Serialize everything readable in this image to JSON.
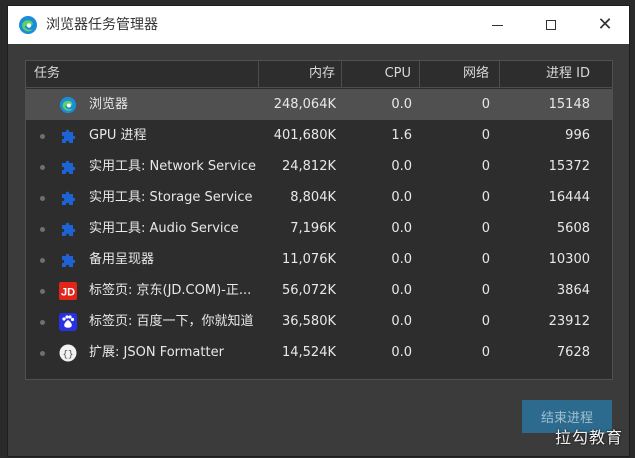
{
  "window": {
    "title": "浏览器任务管理器",
    "minimize_symbol": "",
    "close_symbol": "✕"
  },
  "table": {
    "headers": {
      "task": "任务",
      "memory": "内存",
      "cpu": "CPU",
      "network": "网络",
      "pid": "进程 ID"
    },
    "rows": [
      {
        "name": "浏览器",
        "memory": "248,064K",
        "cpu": "0.0",
        "network": "0",
        "pid": "15148",
        "icon": "edge-icon",
        "selected": true
      },
      {
        "name": "GPU 进程",
        "memory": "401,680K",
        "cpu": "1.6",
        "network": "0",
        "pid": "996",
        "icon": "puzzle-icon",
        "selected": false
      },
      {
        "name": "实用工具: Network Service",
        "memory": "24,812K",
        "cpu": "0.0",
        "network": "0",
        "pid": "15372",
        "icon": "puzzle-icon",
        "selected": false
      },
      {
        "name": "实用工具: Storage Service",
        "memory": "8,804K",
        "cpu": "0.0",
        "network": "0",
        "pid": "16444",
        "icon": "puzzle-icon",
        "selected": false
      },
      {
        "name": "实用工具: Audio Service",
        "memory": "7,196K",
        "cpu": "0.0",
        "network": "0",
        "pid": "5608",
        "icon": "puzzle-icon",
        "selected": false
      },
      {
        "name": "备用呈现器",
        "memory": "11,076K",
        "cpu": "0.0",
        "network": "0",
        "pid": "10300",
        "icon": "puzzle-icon",
        "selected": false
      },
      {
        "name": "标签页: 京东(JD.COM)-正...",
        "memory": "56,072K",
        "cpu": "0.0",
        "network": "0",
        "pid": "3864",
        "icon": "jd-icon",
        "selected": false
      },
      {
        "name": "标签页: 百度一下，你就知道",
        "memory": "36,580K",
        "cpu": "0.0",
        "network": "0",
        "pid": "23912",
        "icon": "baidu-icon",
        "selected": false
      },
      {
        "name": "扩展: JSON Formatter",
        "memory": "14,524K",
        "cpu": "0.0",
        "network": "0",
        "pid": "7628",
        "icon": "json-formatter-icon",
        "selected": false
      }
    ]
  },
  "actions": {
    "end_process_label": "结束进程"
  },
  "watermark": "拉勾教育",
  "colors": {
    "background": "#3b3b3b",
    "panel": "#2d2d2d",
    "selected_row": "#505050",
    "button": "#2d6b8e",
    "edge_blue": "#1a8cd8",
    "puzzle_blue": "#1e63d6",
    "jd_red": "#e1251b",
    "baidu_blue": "#2932e1"
  }
}
